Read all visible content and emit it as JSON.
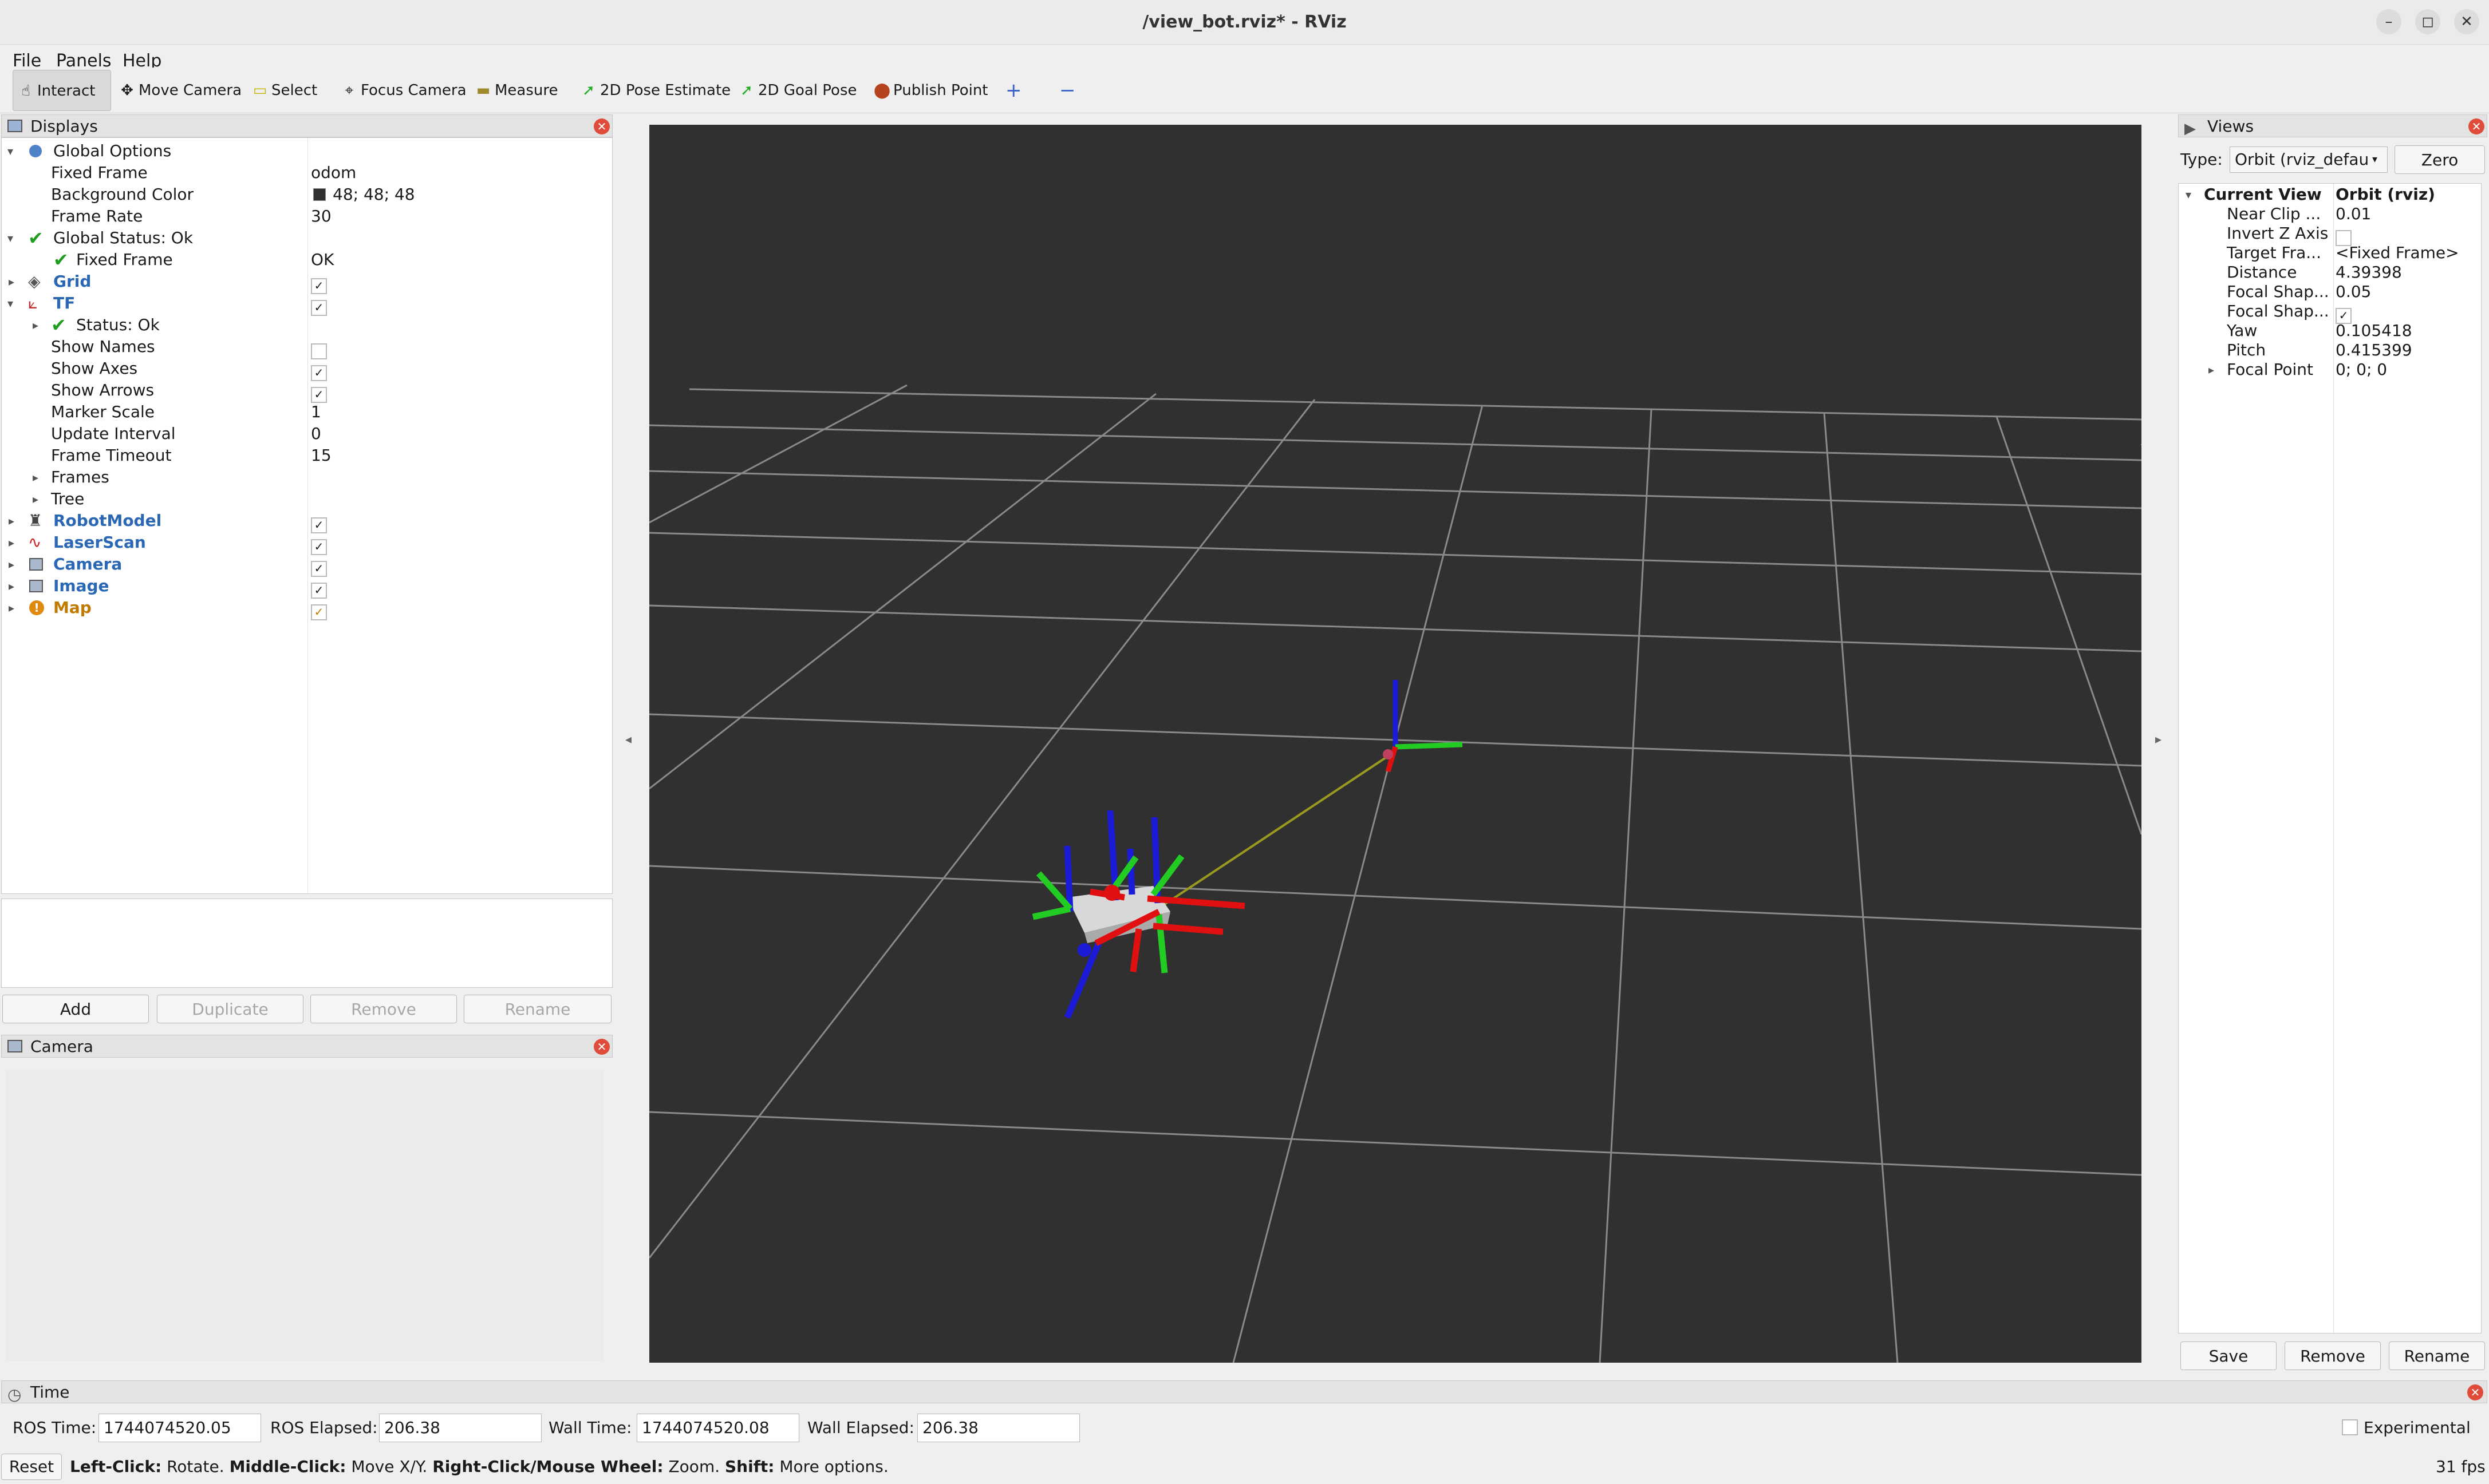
{
  "window": {
    "title": "/view_bot.rviz* - RViz",
    "controls": [
      "–",
      "◻",
      "✕"
    ]
  },
  "menu": [
    "File",
    "Panels",
    "Help"
  ],
  "toolbar": {
    "tools": [
      {
        "label": "Interact",
        "icon": "hand-icon"
      },
      {
        "label": "Move Camera",
        "icon": "move-camera-icon"
      },
      {
        "label": "Select",
        "icon": "select-icon"
      },
      {
        "label": "Focus Camera",
        "icon": "focus-camera-icon"
      },
      {
        "label": "Measure",
        "icon": "measure-icon"
      },
      {
        "label": "2D Pose Estimate",
        "icon": "pose-estimate-icon"
      },
      {
        "label": "2D Goal Pose",
        "icon": "goal-pose-icon"
      },
      {
        "label": "Publish Point",
        "icon": "publish-point-icon"
      }
    ],
    "add_symbol": "+",
    "remove_symbol": "−"
  },
  "displays": {
    "title": "Displays",
    "rows": [
      {
        "name": "Global Options",
        "value": ""
      },
      {
        "name": "Fixed Frame",
        "value": "odom"
      },
      {
        "name": "Background Color",
        "value": "48; 48; 48"
      },
      {
        "name": "Frame Rate",
        "value": "30"
      },
      {
        "name": "Global Status: Ok",
        "value": ""
      },
      {
        "name": "Fixed Frame",
        "value": "OK"
      },
      {
        "name": "Grid",
        "value": ""
      },
      {
        "name": "TF",
        "value": ""
      },
      {
        "name": "Status: Ok",
        "value": ""
      },
      {
        "name": "Show Names",
        "value": ""
      },
      {
        "name": "Show Axes",
        "value": ""
      },
      {
        "name": "Show Arrows",
        "value": ""
      },
      {
        "name": "Marker Scale",
        "value": "1"
      },
      {
        "name": "Update Interval",
        "value": "0"
      },
      {
        "name": "Frame Timeout",
        "value": "15"
      },
      {
        "name": "Frames",
        "value": ""
      },
      {
        "name": "Tree",
        "value": ""
      },
      {
        "name": "RobotModel",
        "value": ""
      },
      {
        "name": "LaserScan",
        "value": ""
      },
      {
        "name": "Camera",
        "value": ""
      },
      {
        "name": "Image",
        "value": ""
      },
      {
        "name": "Map",
        "value": ""
      }
    ],
    "buttons": {
      "add": "Add",
      "duplicate": "Duplicate",
      "remove": "Remove",
      "rename": "Rename"
    },
    "background_color_hex": "#303030"
  },
  "camera_panel": {
    "title": "Camera"
  },
  "views": {
    "title": "Views",
    "type_label": "Type:",
    "type_value": "Orbit (rviz_defau",
    "zero_button": "Zero",
    "header_name": "Current View",
    "header_value": "Orbit (rviz)",
    "rows": [
      {
        "name": "Near Clip ...",
        "value": "0.01"
      },
      {
        "name": "Invert Z Axis",
        "value": ""
      },
      {
        "name": "Target Fra...",
        "value": "<Fixed Frame>"
      },
      {
        "name": "Distance",
        "value": "4.39398"
      },
      {
        "name": "Focal Shap...",
        "value": "0.05"
      },
      {
        "name": "Focal Shap...",
        "value": ""
      },
      {
        "name": "Yaw",
        "value": "0.105418"
      },
      {
        "name": "Pitch",
        "value": "0.415399"
      },
      {
        "name": "Focal Point",
        "value": "0; 0; 0"
      }
    ],
    "buttons": {
      "save": "Save",
      "remove": "Remove",
      "rename": "Rename"
    }
  },
  "time_panel": {
    "title": "Time",
    "ros_time_label": "ROS Time:",
    "ros_time": "1744074520.05",
    "ros_elapsed_label": "ROS Elapsed:",
    "ros_elapsed": "206.38",
    "wall_time_label": "Wall Time:",
    "wall_time": "1744074520.08",
    "wall_elapsed_label": "Wall Elapsed:",
    "wall_elapsed": "206.38",
    "experimental_label": "Experimental"
  },
  "status_bar": {
    "reset": "Reset",
    "hint_parts": [
      {
        "bold": "Left-Click:",
        "text": " Rotate. "
      },
      {
        "bold": "Middle-Click:",
        "text": " Move X/Y. "
      },
      {
        "bold": "Right-Click/Mouse Wheel:",
        "text": " Zoom. "
      },
      {
        "bold": "Shift:",
        "text": " More options."
      }
    ],
    "fps": "31 fps"
  },
  "colors": {
    "axis_x": "#e01010",
    "axis_y": "#22cc22",
    "axis_z": "#1c1cd8",
    "link_line": "#9a9a20",
    "grid": "#8a8a8a"
  }
}
